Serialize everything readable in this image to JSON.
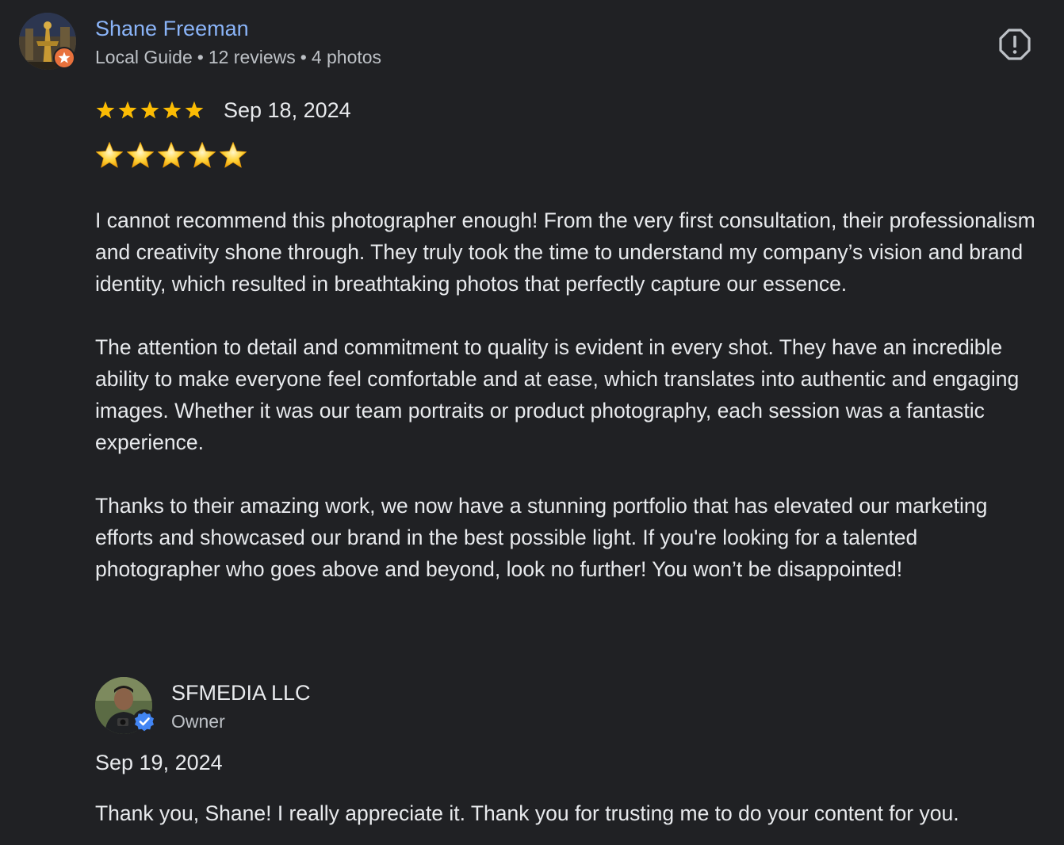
{
  "reviewer": {
    "name": "Shane Freeman",
    "badge": "Local Guide",
    "reviews": "12 reviews",
    "photos": "4 photos",
    "separator": "•"
  },
  "review": {
    "rating": 5,
    "date": "Sep 18, 2024",
    "star_emoji_count": 5,
    "paragraphs": [
      "I cannot recommend this photographer enough! From the very first consultation, their professionalism and creativity shone through. They truly took the time to understand my company’s vision and brand identity, which resulted in breathtaking photos that perfectly capture our essence.",
      "The attention to detail and commitment to quality is evident in every shot. They have an incredible ability to make everyone feel comfortable and at ease, which translates into authentic and engaging images. Whether it was our team portraits or product photography, each session was a fantastic experience.",
      "Thanks to their amazing work, we now have a stunning portfolio that has elevated our marketing efforts and showcased our brand in the best possible light. If you're looking for a talented photographer who goes above and beyond, look no further! You won’t be disappointed!"
    ]
  },
  "owner_response": {
    "name": "SFMEDIA LLC",
    "role": "Owner",
    "date": "Sep 19, 2024",
    "text": "Thank you, Shane! I really appreciate it. Thank you for trusting me to do your content for you."
  },
  "icons": {
    "report": "report-icon",
    "local_guide_badge": "star-badge-icon",
    "verified_badge": "verified-check-icon"
  },
  "colors": {
    "background": "#202124",
    "name_link": "#8ab4f8",
    "star_small": "#fbbc04",
    "guide_badge": "#e8713c",
    "verified_badge": "#4285f4"
  }
}
